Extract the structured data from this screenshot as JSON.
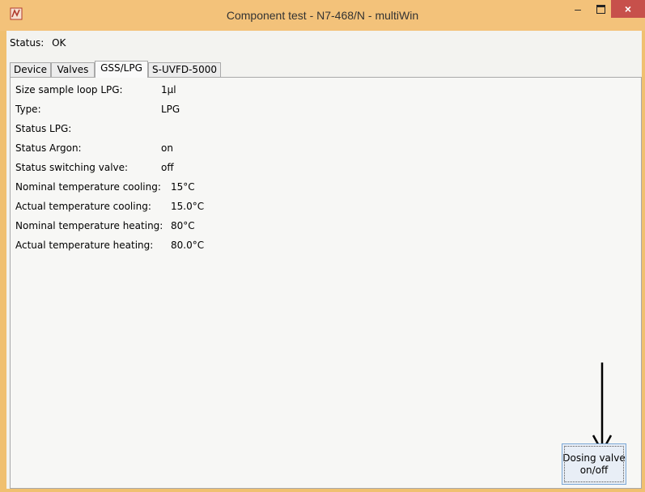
{
  "window": {
    "title": "Component test - N7-468/N - multiWin",
    "minimize_glyph": "–",
    "close_glyph": "×"
  },
  "status": {
    "label": "Status:",
    "value": "OK"
  },
  "tabs": [
    {
      "label": "Device",
      "active": false
    },
    {
      "label": "Valves",
      "active": false
    },
    {
      "label": "GSS/LPG",
      "active": true
    },
    {
      "label": "S-UVFD-5000",
      "active": false
    }
  ],
  "rows": [
    {
      "label": "Size sample loop LPG:",
      "value": "1µl"
    },
    {
      "label": "Type:",
      "value": "LPG"
    },
    {
      "label": "Status LPG:",
      "value": ""
    },
    {
      "label": "Status Argon:",
      "value": "on"
    },
    {
      "label": "Status switching valve:",
      "value": "off"
    },
    {
      "label": "Nominal temperature cooling:",
      "value": "15°C"
    },
    {
      "label": "Actual temperature cooling:",
      "value": "15.0°C"
    },
    {
      "label": "Nominal temperature heating:",
      "value": "80°C"
    },
    {
      "label": "Actual temperature heating:",
      "value": "80.0°C"
    }
  ],
  "dosing_button": {
    "line1": "Dosing valve",
    "line2": "on/off"
  },
  "colors": {
    "titlebar": "#f3c27a",
    "close_button": "#c7504b",
    "frame": "#f0c070"
  }
}
